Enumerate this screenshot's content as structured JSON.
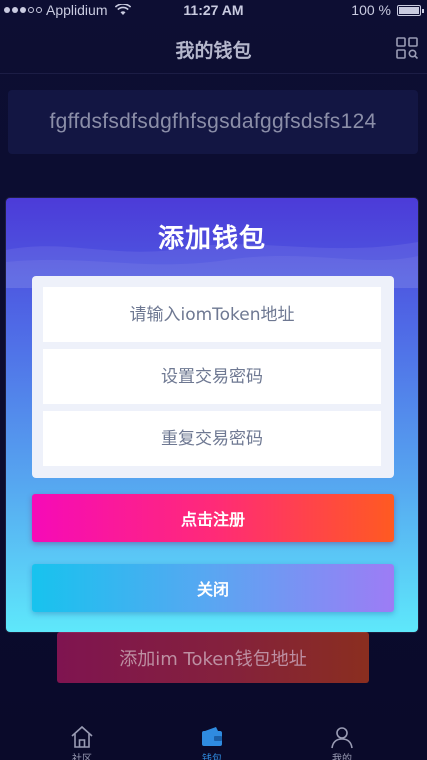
{
  "status_bar": {
    "carrier": "Applidium",
    "time": "11:27 AM",
    "battery": "100 %"
  },
  "header": {
    "title": "我的钱包",
    "scan_icon": "qr-scan-icon"
  },
  "wallet": {
    "address": "fgffdsfsdfsdgfhfsgsdafggfsdsfs124"
  },
  "background": {
    "add_button_label": "添加im Token钱包地址"
  },
  "modal": {
    "title": "添加钱包",
    "fields": {
      "address_placeholder": "请输入iomToken地址",
      "password_placeholder": "设置交易密码",
      "confirm_placeholder": "重复交易密码"
    },
    "register_label": "点击注册",
    "close_label": "关闭"
  },
  "tab_bar": {
    "tabs": [
      {
        "label": "社区",
        "icon": "home-icon"
      },
      {
        "label": "钱包",
        "icon": "wallet-icon",
        "active": true
      },
      {
        "label": "我的",
        "icon": "user-icon"
      }
    ]
  },
  "colors": {
    "background": "#0b0b2e",
    "modal_top": "#4c3bd8",
    "modal_bottom": "#5ee8fb",
    "register_start": "#f60ab8",
    "register_end": "#ff5a21",
    "close_start": "#17c3ee",
    "close_end": "#9d7cf5",
    "active_tab": "#2f8be0"
  }
}
